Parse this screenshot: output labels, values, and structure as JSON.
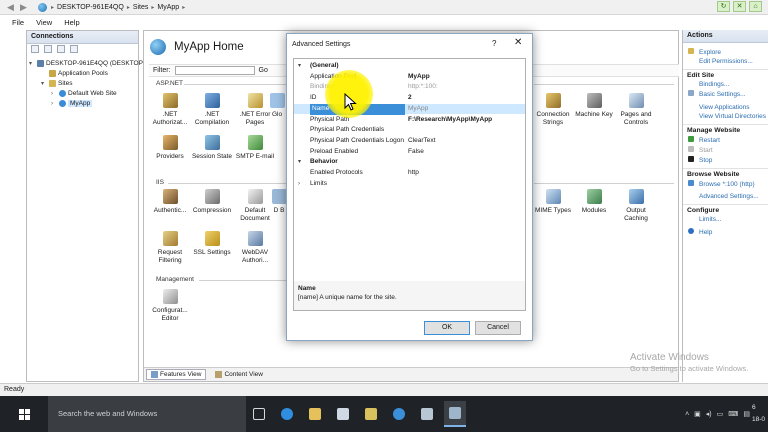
{
  "address": {
    "crumbs": [
      "DESKTOP-961E4QQ",
      "Sites",
      "MyApp"
    ]
  },
  "menu": [
    "File",
    "View",
    "Help"
  ],
  "connections": {
    "title": "Connections",
    "tree": [
      {
        "label": "DESKTOP-961E4QQ (DESKTOP",
        "level": 0,
        "twisty": "▾"
      },
      {
        "label": "Application Pools",
        "level": 1,
        "twisty": ""
      },
      {
        "label": "Sites",
        "level": 1,
        "twisty": "▾"
      },
      {
        "label": "Default Web Site",
        "level": 2,
        "twisty": "›"
      },
      {
        "label": "MyApp",
        "level": 2,
        "twisty": "›"
      }
    ]
  },
  "center": {
    "title": "MyApp Home",
    "filter_label": "Filter:",
    "go_label": "Go",
    "group_aspnet": "ASP.NET",
    "group_iis": "IIS",
    "group_management": "Management",
    "features": [
      ".NET Authorizat...",
      ".NET Compilation",
      ".NET Error Pages",
      "Glo",
      "Providers",
      "Session State",
      "SMTP E-mail",
      "Authentic...",
      "Compression",
      "Default Document",
      "D B",
      "Request Filtering",
      "SSL Settings",
      "WebDAV Authori...",
      "Configurat... Editor",
      "Connection Strings",
      "Machine Key",
      "Pages and Controls",
      "MIME Types",
      "Modules",
      "Output Caching"
    ],
    "views": {
      "features": "Features View",
      "content": "Content View"
    }
  },
  "dialog": {
    "title": "Advanced Settings",
    "help": "?",
    "close": "✕",
    "rows": [
      {
        "kind": "cat",
        "key": "(General)",
        "value": "",
        "twisty": "▾"
      },
      {
        "kind": "prop",
        "key": "Application Pool",
        "value": "MyApp"
      },
      {
        "kind": "dim",
        "key": "Bindings",
        "value": "http:*:100:"
      },
      {
        "kind": "prop",
        "key": "ID",
        "value": "2"
      },
      {
        "kind": "sel",
        "key": "Name",
        "value": "MyApp"
      },
      {
        "kind": "prop",
        "key": "Physical Path",
        "value": "F:\\Research\\MyApp\\MyApp"
      },
      {
        "kind": "prop",
        "key": "Physical Path Credentials",
        "value": ""
      },
      {
        "kind": "prop",
        "key": "Physical Path Credentials Logon",
        "value": "ClearText"
      },
      {
        "kind": "prop",
        "key": "Preload Enabled",
        "value": "False"
      },
      {
        "kind": "cat",
        "key": "Behavior",
        "value": "",
        "twisty": "▾"
      },
      {
        "kind": "prop",
        "key": "Enabled Protocols",
        "value": "http"
      },
      {
        "kind": "prop",
        "key": "Limits",
        "value": "",
        "twisty": "›"
      }
    ],
    "desc_title": "Name",
    "desc_text": "[name] A unique name for the site.",
    "ok": "OK",
    "cancel": "Cancel"
  },
  "actions": {
    "title": "Actions",
    "explore": "Explore",
    "edit_permissions": "Edit Permissions...",
    "edit_site": "Edit Site",
    "bindings": "Bindings...",
    "basic_settings": "Basic Settings...",
    "view_applications": "View Applications",
    "view_virtual_dirs": "View Virtual Directories",
    "manage_website": "Manage Website",
    "restart": "Restart",
    "start": "Start",
    "stop": "Stop",
    "browse_website": "Browse Website",
    "browse_100": "Browse *:100 (http)",
    "advanced_settings": "Advanced Settings...",
    "configure": "Configure",
    "limits": "Limits...",
    "help": "Help"
  },
  "status": "Ready",
  "watermark": {
    "line1": "Activate Windows",
    "line2": "Go to Settings to activate Windows."
  },
  "taskbar": {
    "search_placeholder": "Search the web and Windows",
    "clock_time": "6",
    "clock_date": "18-0"
  }
}
